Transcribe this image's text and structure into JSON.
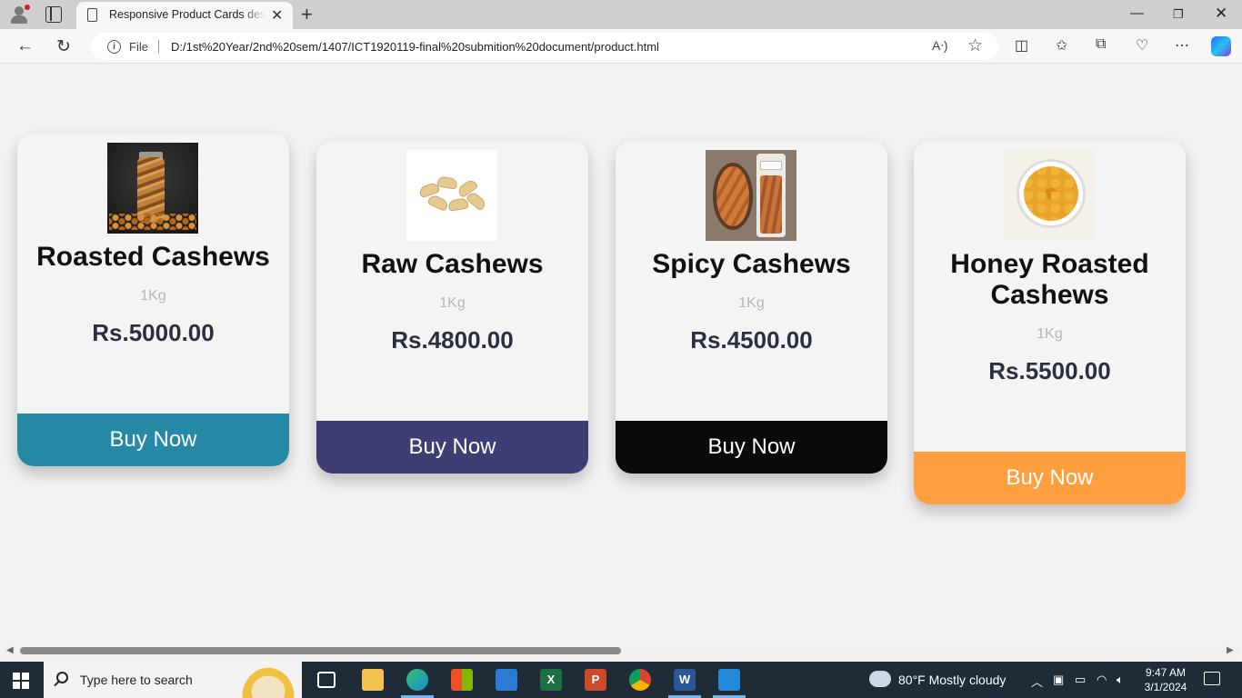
{
  "browser": {
    "tab_title": "Responsive Product Cards design",
    "address_prefix": "File",
    "url": "D:/1st%20Year/2nd%20sem/1407/ICT1920119-final%20submition%20document/product.html",
    "icons": [
      "profile-icon",
      "tab-actions-icon",
      "page-icon",
      "close-icon",
      "new-tab-icon",
      "minimize-icon",
      "restore-icon",
      "window-close-icon",
      "back-icon",
      "refresh-icon",
      "info-icon",
      "read-aloud-icon",
      "favorite-star-icon",
      "split-screen-icon",
      "favorites-icon",
      "collections-icon",
      "performance-icon",
      "more-icon",
      "copilot-icon"
    ]
  },
  "products": [
    {
      "name": "Roasted Cashews",
      "weight": "1Kg",
      "price": "Rs.5000.00",
      "button": "Buy Now",
      "button_color": "#2589a5"
    },
    {
      "name": "Raw Cashews",
      "weight": "1Kg",
      "price": "Rs.4800.00",
      "button": "Buy Now",
      "button_color": "#3e3d74"
    },
    {
      "name": "Spicy Cashews",
      "weight": "1Kg",
      "price": "Rs.4500.00",
      "button": "Buy Now",
      "button_color": "#0a0a0a"
    },
    {
      "name": "Honey Roasted Cashews",
      "weight": "1Kg",
      "price": "Rs.5500.00",
      "button": "Buy Now",
      "button_color": "#ff9f3f"
    }
  ],
  "taskbar": {
    "search_placeholder": "Type here to search",
    "weather": "80°F  Mostly cloudy",
    "time": "9:47 AM",
    "date": "3/1/2024"
  }
}
